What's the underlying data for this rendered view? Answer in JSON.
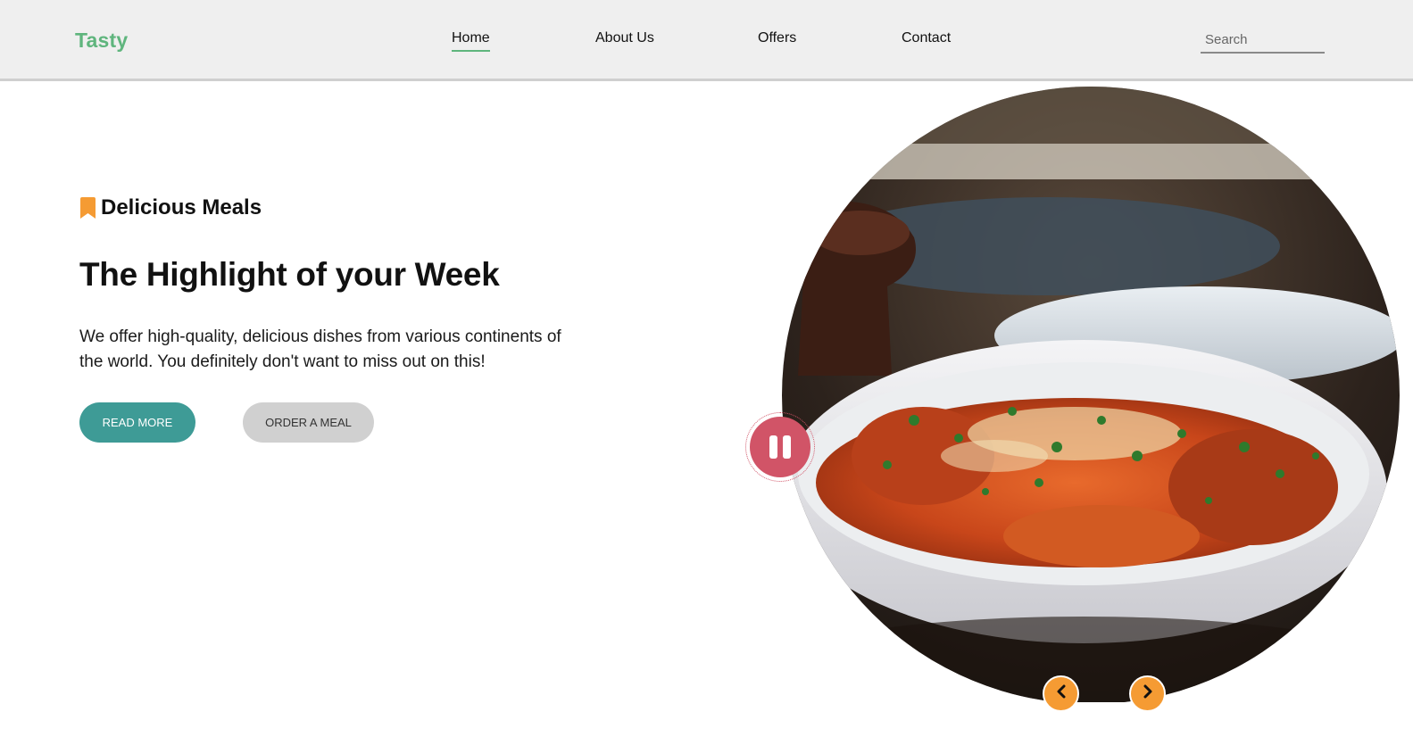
{
  "header": {
    "logo": "Tasty",
    "nav": [
      {
        "label": "Home",
        "active": true
      },
      {
        "label": "About Us",
        "active": false
      },
      {
        "label": "Offers",
        "active": false
      },
      {
        "label": "Contact",
        "active": false
      }
    ],
    "search": {
      "placeholder": "Search",
      "value": ""
    }
  },
  "hero": {
    "tagline": "Delicious Meals",
    "headline": "The Highlight of your Week",
    "description": "We offer high-quality, delicious dishes from various continents of the world. You definitely don't want to miss out on this!",
    "primary_button": "READ MORE",
    "secondary_button": "ORDER A MEAL",
    "image": {
      "subject": "spaghetti and meatballs in a white bowl"
    }
  },
  "colors": {
    "brand_green": "#5fb57d",
    "teal_button": "#3e9b96",
    "grey_button": "#d0d0d0",
    "bookmark_orange": "#f59b33",
    "pause_red": "#d15467",
    "arrow_orange": "#f59b33",
    "header_bg": "#efefef"
  },
  "icons": {
    "tagline": "bookmark-icon",
    "slider_control": "pause-icon",
    "prev": "chevron-left-icon",
    "next": "chevron-right-icon"
  }
}
